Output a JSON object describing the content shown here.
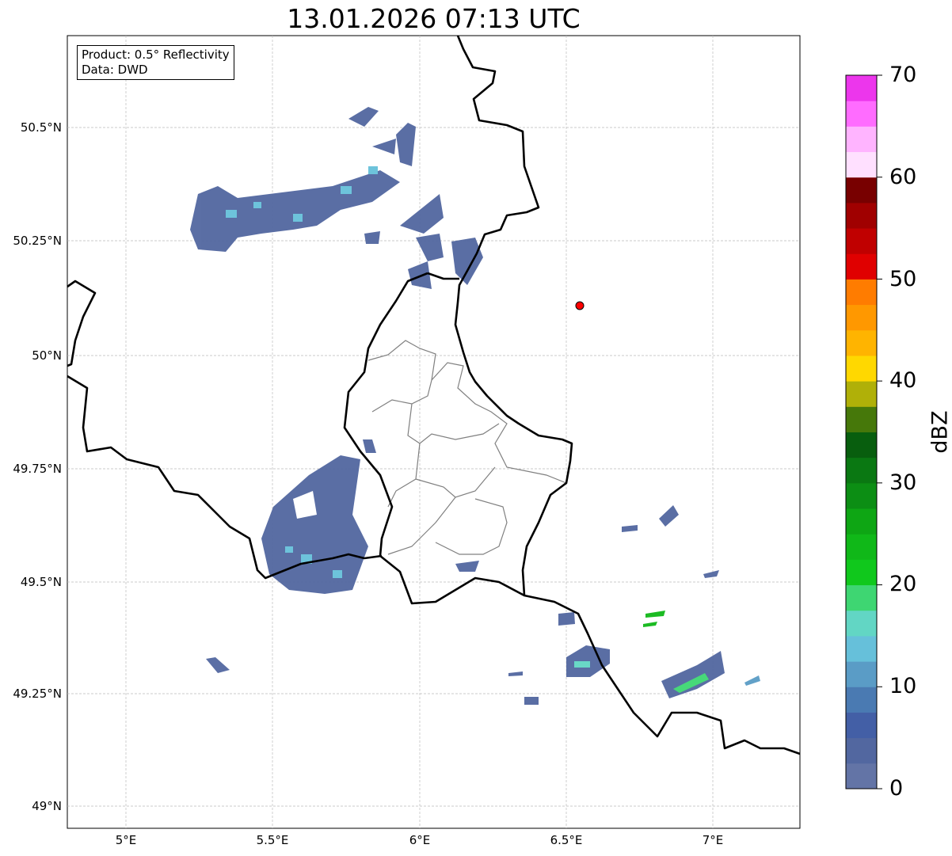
{
  "title": "13.01.2026 07:13 UTC",
  "legend": {
    "product": "Product: 0.5° Reflectivity",
    "data": "Data: DWD"
  },
  "lat_labels": [
    "50.5°N",
    "50.25°N",
    "50°N",
    "49.75°N",
    "49.5°N",
    "49.25°N",
    "49°N"
  ],
  "lon_labels": [
    "5°E",
    "5.5°E",
    "6°E",
    "6.5°E",
    "7°E"
  ],
  "colorbar": {
    "label": "dBZ",
    "ticks": [
      "0",
      "10",
      "20",
      "30",
      "40",
      "50",
      "60",
      "70"
    ],
    "range": [
      0,
      70
    ],
    "step": 2.5,
    "colors": [
      "#6374a6",
      "#5267a0",
      "#435fa6",
      "#4a7ab2",
      "#5a9cc6",
      "#66c0da",
      "#62d6c4",
      "#3ed672",
      "#10c81c",
      "#10b818",
      "#0ea614",
      "#0c8e14",
      "#0a7812",
      "#085e0e",
      "#46780a",
      "#b0b008",
      "#ffd800",
      "#ffb400",
      "#ff9800",
      "#ff7c00",
      "#e00000",
      "#c00000",
      "#a00000",
      "#780000",
      "#ffe0ff",
      "#ffb4ff",
      "#ff6cff",
      "#ec36ec"
    ]
  },
  "marker": {
    "color": "#ff0000"
  }
}
